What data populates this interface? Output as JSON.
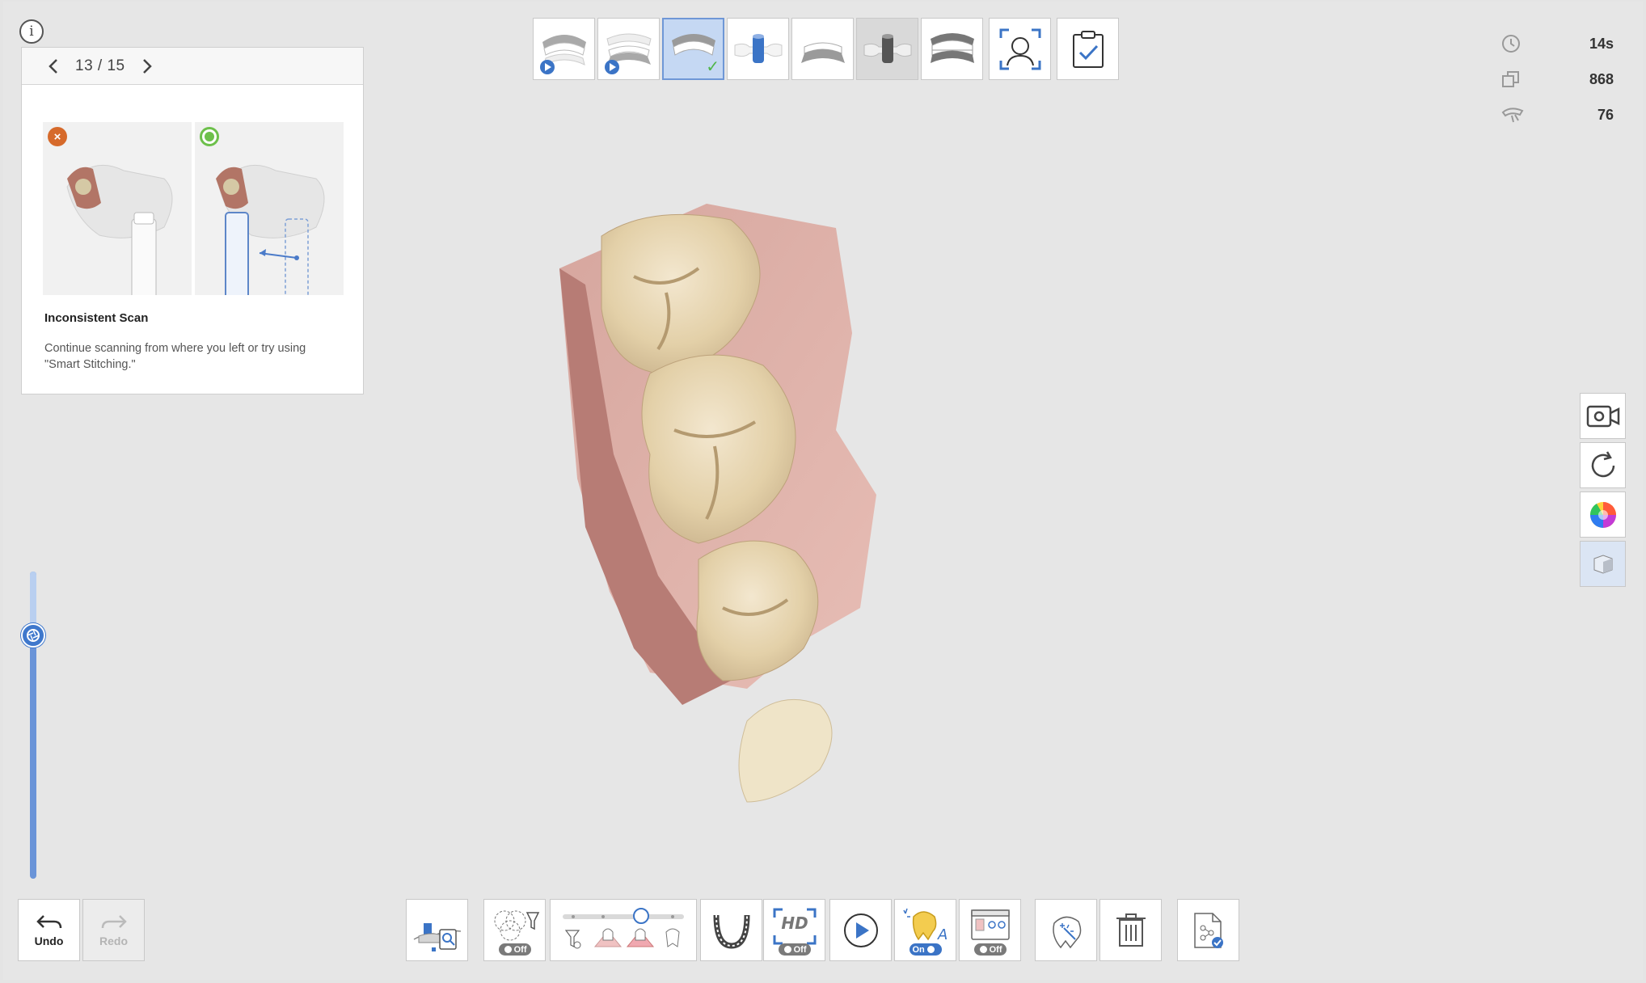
{
  "guide": {
    "page": "13 / 15",
    "title": "Inconsistent Scan",
    "description": "Continue scanning from where you left or try using \"Smart Stitching.\""
  },
  "stats": {
    "time": "14s",
    "images": "868",
    "angle": "76"
  },
  "undo": {
    "label": "Undo"
  },
  "redo": {
    "label": "Redo"
  },
  "toggles": {
    "filter": "Off",
    "hd": "Off",
    "ai": "On",
    "compare": "Off"
  },
  "colors": {
    "accent": "#3b74c6",
    "active_stage": "#c5d8f3",
    "bad": "#d66a2b",
    "good": "#6dc04b"
  },
  "sliders": {
    "left_vertical_level": 0.21,
    "filter_level": 0.65
  }
}
